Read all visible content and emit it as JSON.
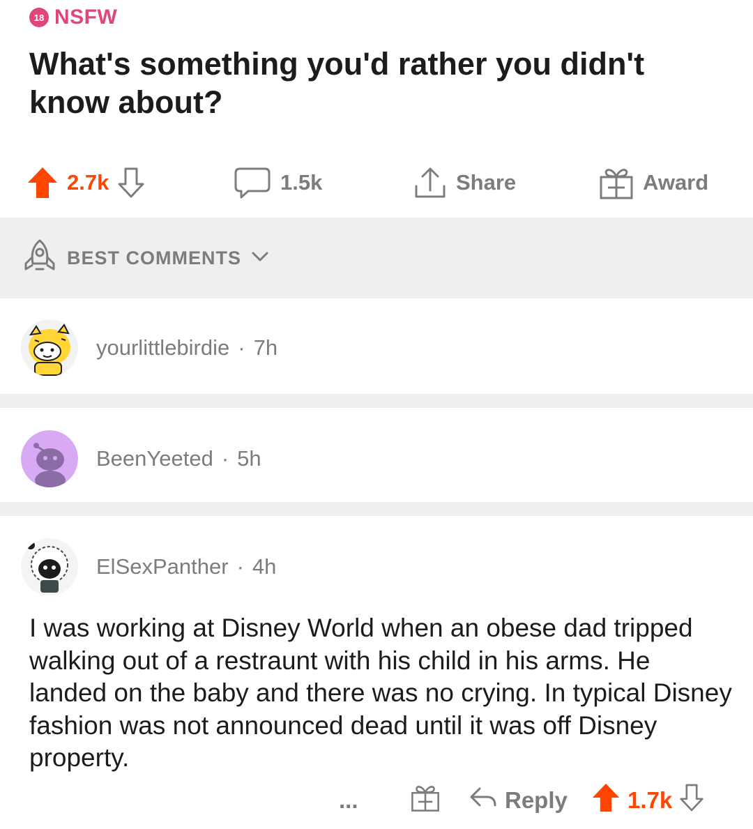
{
  "post": {
    "nsfw_badge": "18",
    "nsfw_label": "NSFW",
    "title": "What's something you'd rather you didn't know about?",
    "upvotes": "2.7k",
    "comments": "1.5k",
    "share_label": "Share",
    "award_label": "Award"
  },
  "sort": {
    "label": "BEST COMMENTS"
  },
  "comments": [
    {
      "author": "yourlittlebirdie",
      "age": "7h"
    },
    {
      "author": "BeenYeeted",
      "age": "5h"
    },
    {
      "author": "ElSexPanther",
      "age": "4h",
      "body": "I was working at Disney World when an obese dad tripped walking out of a restraunt with his child in his arms. He landed on the baby and there was no crying. In typical Disney fashion was not announced dead until it was off Disney property.",
      "more_label": "...",
      "reply_label": "Reply",
      "upvotes": "1.7k"
    }
  ],
  "colors": {
    "upvote": "#ff4500",
    "nsfw": "#e0457b",
    "muted": "#7c7c7c",
    "separator": "#edeff1"
  }
}
